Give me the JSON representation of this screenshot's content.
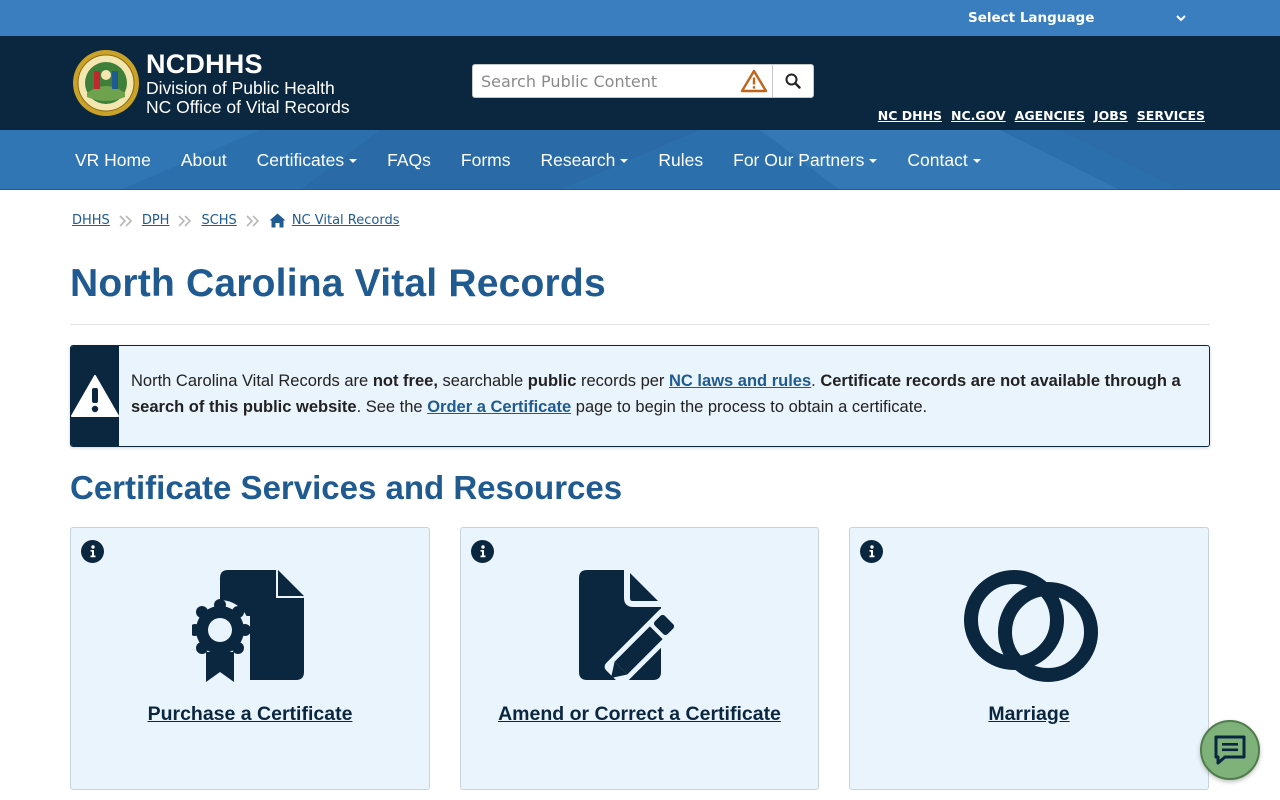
{
  "language_bar": {
    "label": "Select Language"
  },
  "header": {
    "brand": "NCDHHS",
    "division": "Division of Public Health",
    "office": "NC Office of Vital Records",
    "search_placeholder": "Search Public Content",
    "util_links": [
      "NC DHHS",
      "NC.GOV",
      "AGENCIES",
      "JOBS",
      "SERVICES"
    ]
  },
  "nav": {
    "items": [
      {
        "label": "VR Home",
        "dropdown": false
      },
      {
        "label": "About",
        "dropdown": false
      },
      {
        "label": "Certificates",
        "dropdown": true
      },
      {
        "label": "FAQs",
        "dropdown": false
      },
      {
        "label": "Forms",
        "dropdown": false
      },
      {
        "label": "Research",
        "dropdown": true
      },
      {
        "label": "Rules",
        "dropdown": false
      },
      {
        "label": "For Our Partners",
        "dropdown": true
      },
      {
        "label": "Contact",
        "dropdown": true
      }
    ]
  },
  "breadcrumb": [
    "DHHS",
    "DPH",
    "SCHS",
    "NC Vital Records"
  ],
  "page": {
    "title": "North Carolina Vital Records",
    "section_title": "Certificate Services and Resources"
  },
  "alert": {
    "t1": "North Carolina Vital Records are ",
    "b1": "not free,",
    "t2": " searchable ",
    "b2": "public",
    "t3": " records per ",
    "link1": "NC laws and rules",
    "t4": ". ",
    "b3": "Certificate records are not available through a search of this public website",
    "t5": ". See the ",
    "link2": "Order a Certificate",
    "t6": " page to begin the process to obtain a certificate."
  },
  "cards": [
    {
      "title": "Purchase a Certificate",
      "icon": "certificate-award-icon"
    },
    {
      "title": "Amend or Correct a Certificate",
      "icon": "file-edit-icon"
    },
    {
      "title": "Marriage",
      "icon": "rings-icon"
    }
  ],
  "colors": {
    "lang_bar": "#3a7ebf",
    "header": "#0b2740",
    "nav": "#2c6fad",
    "heading": "#1f5a91",
    "card_bg": "#eaf4fc",
    "chat": "#7fb27b"
  }
}
